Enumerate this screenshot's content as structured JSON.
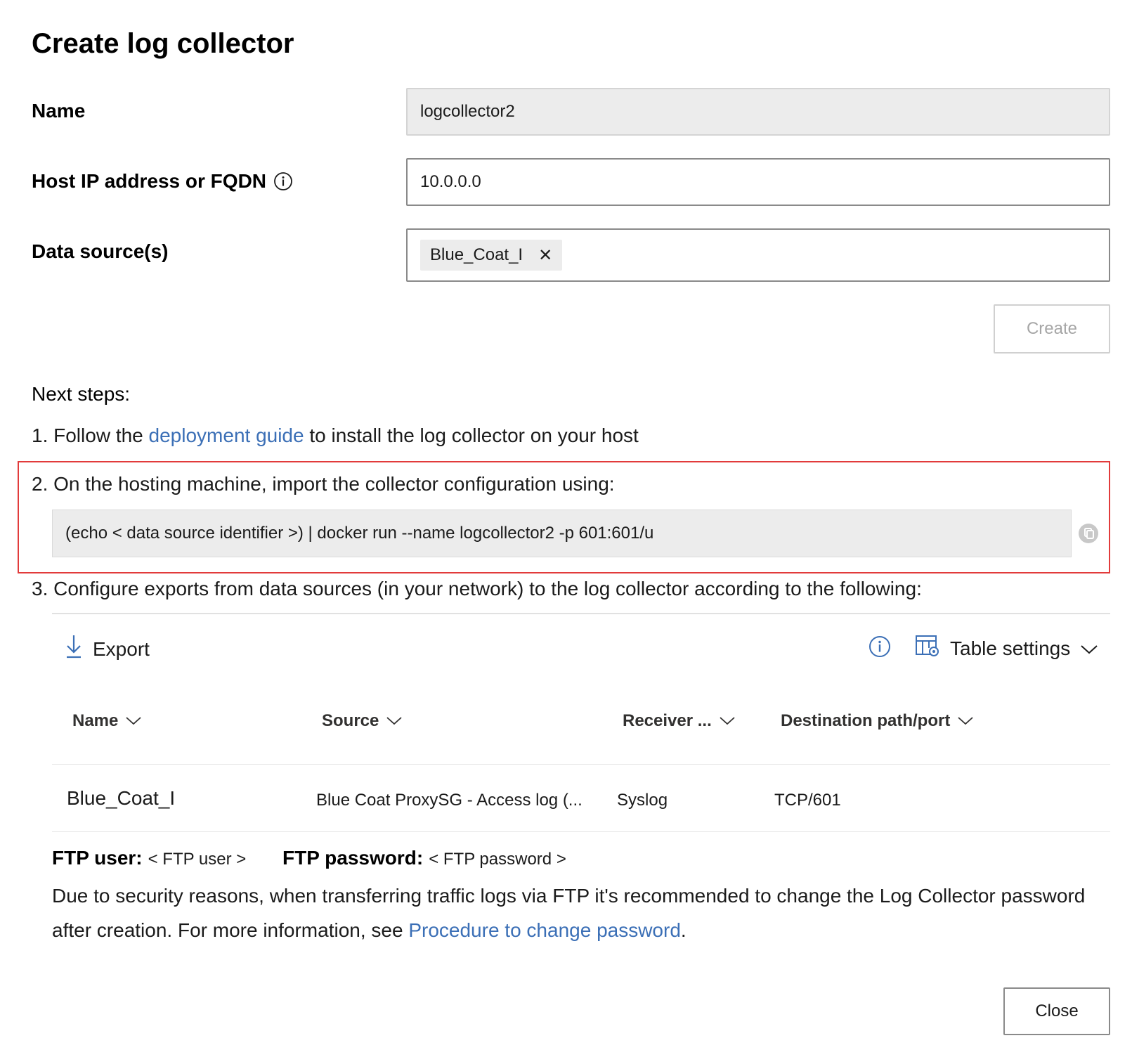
{
  "dialog": {
    "title": "Create log collector"
  },
  "form": {
    "name": {
      "label": "Name",
      "value": "logcollector2"
    },
    "host": {
      "label": "Host IP address or FQDN",
      "value": "10.0.0.0"
    },
    "data_sources": {
      "label": "Data source(s)",
      "chips": [
        "Blue_Coat_I"
      ],
      "remove_glyph": "✕"
    },
    "create_label": "Create"
  },
  "next_steps": {
    "heading": "Next steps:",
    "step1": {
      "prefix": "1. Follow the ",
      "link": "deployment guide",
      "suffix": " to install the log collector on your host"
    },
    "step2": {
      "text": "2. On the hosting machine, import the collector configuration using:"
    },
    "command": "(echo < data source identifier >) | docker run --name logcollector2 -p 601:601/u",
    "step3": {
      "text": "3. Configure exports from data sources (in your network) to the log collector according to the following:"
    }
  },
  "table": {
    "toolbar": {
      "export_label": "Export",
      "table_settings_label": "Table settings"
    },
    "columns": [
      {
        "key": "name",
        "label": "Name"
      },
      {
        "key": "source",
        "label": "Source"
      },
      {
        "key": "receiver",
        "label": "Receiver ..."
      },
      {
        "key": "destination",
        "label": "Destination path/port"
      }
    ],
    "rows": [
      {
        "name": "Blue_Coat_I",
        "source": "Blue Coat ProxySG - Access log (...",
        "receiver": "Syslog",
        "destination": "TCP/601"
      }
    ]
  },
  "ftp": {
    "user_label": "FTP user:",
    "user_value": "< FTP user >",
    "password_label": "FTP password:",
    "password_value": "< FTP password >",
    "note_text": "Due to security reasons, when transferring traffic logs via FTP it's recommended to change the Log Collector password after creation. For more information, see ",
    "note_link": "Procedure to change password",
    "note_end": "."
  },
  "footer": {
    "close_label": "Close"
  },
  "colors": {
    "link": "#3b6fb6",
    "highlight": "#e23b3b",
    "readonly_bg": "#ececec"
  },
  "icons": {
    "info": "info-circle-icon",
    "remove": "close-icon",
    "copy": "copy-icon",
    "export": "download-arrow-icon",
    "table_settings": "table-settings-icon",
    "chevron": "chevron-down-icon"
  }
}
